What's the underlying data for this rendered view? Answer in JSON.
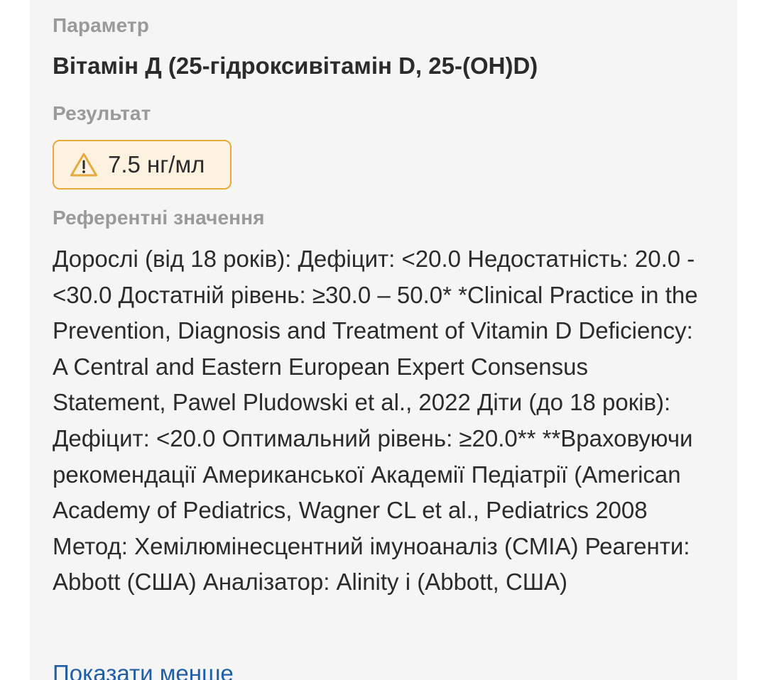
{
  "parameter": {
    "label": "Параметр",
    "value": "Вітамін Д (25-гідроксивітамін D, 25-(OH)D)"
  },
  "result": {
    "label": "Результат",
    "value": "7.5 нг/мл",
    "icon": "warning-icon",
    "border_color": "#e8a93e",
    "background_color": "#fdf2df"
  },
  "reference": {
    "label": "Референтні значення",
    "text": "Дорослі (від 18 років): Дефіцит: <20.0 Недостатність: 20.0 - <30.0 Достатній рівень: ≥30.0 – 50.0* *Clinical Practice in the Prevention, Diagnosis and Treatment of Vitamin D Deficiency: A Central and Eastern European Expert Consensus Statement, Pawel Pludowski et al., 2022 Діти (до 18 років): Дефіцит: <20.0 Оптимальний рівень: ≥20.0** **Враховуючи рекомендації Американської Академії Педіатрії (American Academy of Pediatrics, Wagner CL et al., Pediatrics 2008 Метод: Хемілюмінесцентний імуноаналіз (CMIA) Реагенти: Abbott (США) Аналізатор: Alinity i (Abbott, США)"
  },
  "actions": {
    "show_less": "Показати менше"
  }
}
